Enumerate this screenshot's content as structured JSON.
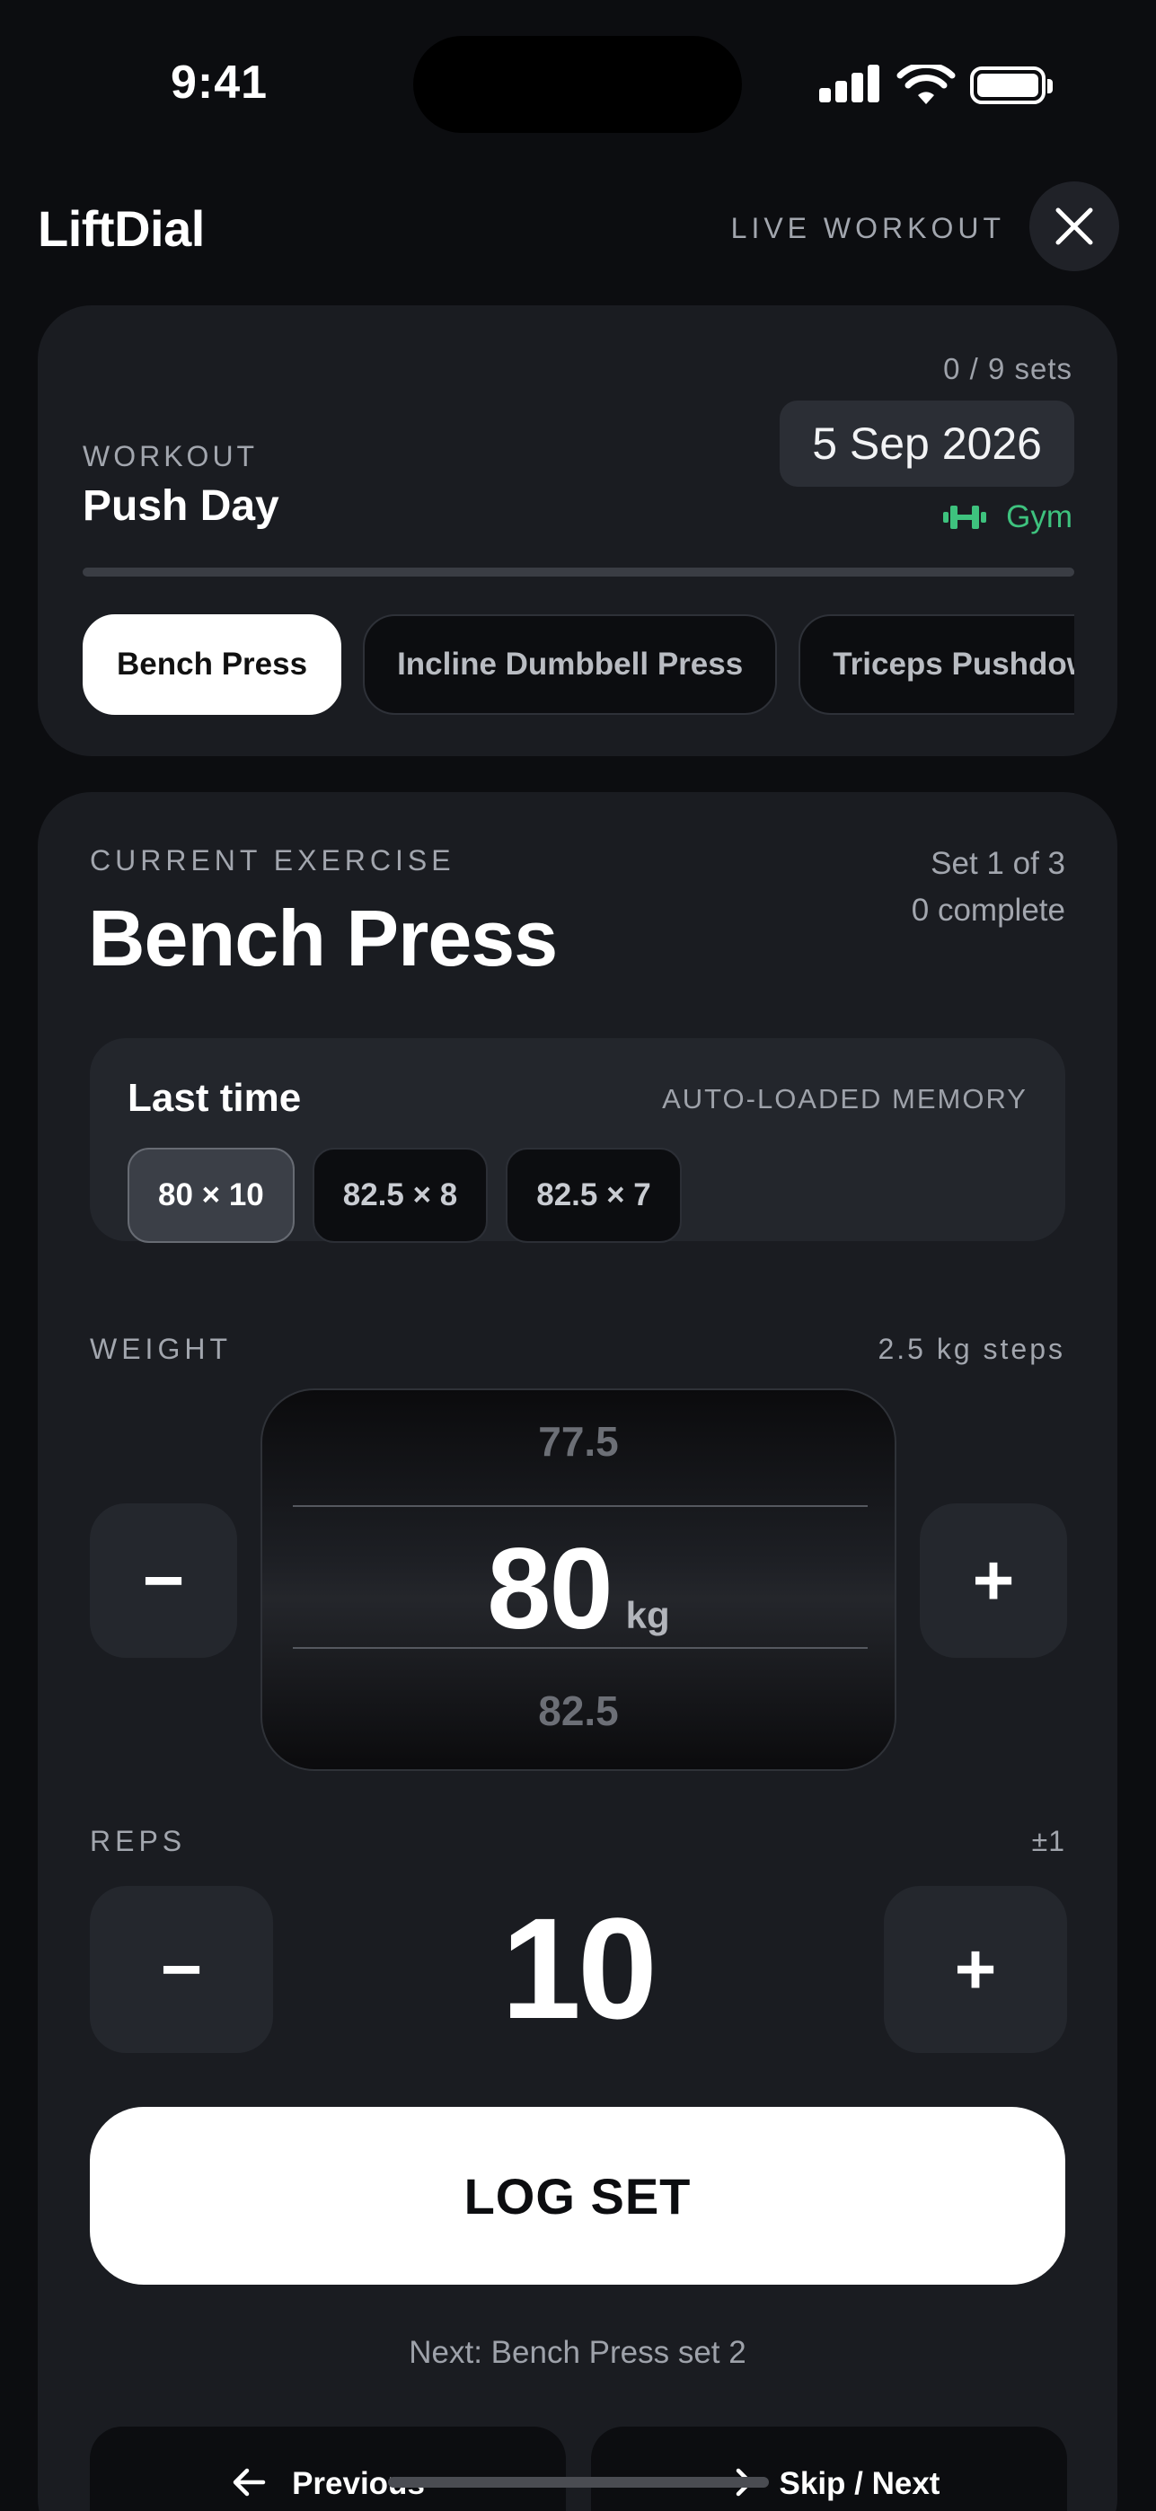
{
  "status_bar": {
    "time": "9:41"
  },
  "header": {
    "brand": "LiftDial",
    "mode_label": "LIVE WORKOUT",
    "close_icon": "close-icon"
  },
  "workout": {
    "sets_progress": "0 / 9 sets",
    "date": "5 Sep 2026",
    "location": "Gym",
    "location_color": "#3ec27e",
    "label": "WORKOUT",
    "name": "Push Day",
    "progress_fraction": 0,
    "exercises": [
      {
        "label": "Bench Press",
        "active": true
      },
      {
        "label": "Incline Dumbbell Press",
        "active": false
      },
      {
        "label": "Triceps Pushdown",
        "active": false
      }
    ]
  },
  "exercise": {
    "section_label": "CURRENT EXERCISE",
    "name": "Bench Press",
    "set_position": "Set 1 of 3",
    "complete_count": "0 complete",
    "last_time": {
      "title": "Last time",
      "memory_label": "AUTO-LOADED MEMORY",
      "sets": [
        "80 × 10",
        "82.5 × 8",
        "82.5 × 7"
      ]
    },
    "weight": {
      "label": "WEIGHT",
      "step_hint": "2.5 kg steps",
      "previous": "77.5",
      "value": "80",
      "unit": "kg",
      "next": "82.5",
      "minus": "−",
      "plus": "+"
    },
    "reps": {
      "label": "REPS",
      "step_hint": "±1",
      "value": "10",
      "minus": "−",
      "plus": "+"
    },
    "log_button": "LOG SET",
    "next_text": "Next: Bench Press set 2",
    "nav": {
      "previous": "Previous",
      "skip_next": "Skip / Next"
    }
  }
}
